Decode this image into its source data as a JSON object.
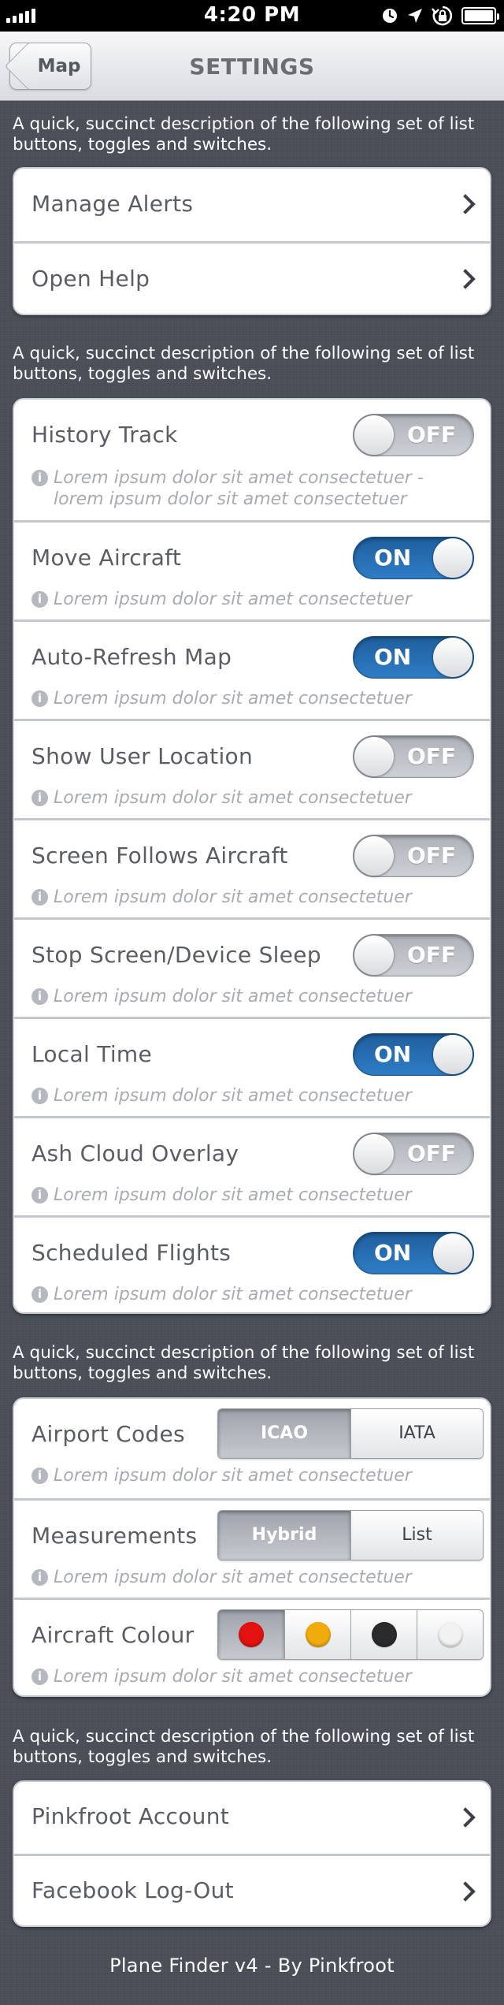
{
  "status_bar": {
    "time": "4:20 PM"
  },
  "nav": {
    "title": "SETTINGS",
    "back_label": "Map"
  },
  "section_descriptions": [
    "A quick, succinct description of the following set of list buttons, toggles and switches.",
    "A quick, succinct description of the following set of list buttons, toggles and switches.",
    "A quick, succinct description of the following set of list buttons, toggles and switches.",
    "A quick, succinct description of the following set of list buttons, toggles and switches."
  ],
  "group1": [
    {
      "label": "Manage Alerts"
    },
    {
      "label": "Open Help"
    }
  ],
  "toggles": [
    {
      "label": "History Track",
      "state": "OFF",
      "note": "Lorem ipsum dolor sit amet consectetuer - lorem ipsum dolor sit amet consectetuer"
    },
    {
      "label": "Move Aircraft",
      "state": "ON",
      "note": "Lorem ipsum dolor sit amet consectetuer"
    },
    {
      "label": "Auto-Refresh Map",
      "state": "ON",
      "note": "Lorem ipsum dolor sit amet consectetuer"
    },
    {
      "label": "Show User Location",
      "state": "OFF",
      "note": "Lorem ipsum dolor sit amet consectetuer"
    },
    {
      "label": "Screen Follows Aircraft",
      "state": "OFF",
      "note": "Lorem ipsum dolor sit amet consectetuer"
    },
    {
      "label": "Stop Screen/Device Sleep",
      "state": "OFF",
      "note": "Lorem ipsum dolor sit amet consectetuer"
    },
    {
      "label": "Local Time",
      "state": "ON",
      "note": "Lorem ipsum dolor sit amet consectetuer"
    },
    {
      "label": "Ash Cloud Overlay",
      "state": "OFF",
      "note": "Lorem ipsum dolor sit amet consectetuer"
    },
    {
      "label": "Scheduled Flights",
      "state": "ON",
      "note": "Lorem ipsum dolor sit amet consectetuer"
    }
  ],
  "segments": {
    "airport_codes": {
      "label": "Airport Codes",
      "options": [
        "ICAO",
        "IATA"
      ],
      "selected": "ICAO",
      "note": "Lorem ipsum dolor sit amet consectetuer"
    },
    "measurements": {
      "label": "Measurements",
      "options": [
        "Hybrid",
        "List"
      ],
      "selected": "Hybrid",
      "note": "Lorem ipsum dolor sit amet consectetuer"
    },
    "aircraft_colour": {
      "label": "Aircraft Colour",
      "colours": [
        "#e41111",
        "#f2ab0c",
        "#2b2b2b",
        "#f2f2f2"
      ],
      "selected_index": 0,
      "note": "Lorem ipsum dolor sit amet consectetuer"
    }
  },
  "group4": [
    {
      "label": "Pinkfroot Account"
    },
    {
      "label": "Facebook Log-Out"
    }
  ],
  "footer": "Plane Finder v4 - By Pinkfroot"
}
